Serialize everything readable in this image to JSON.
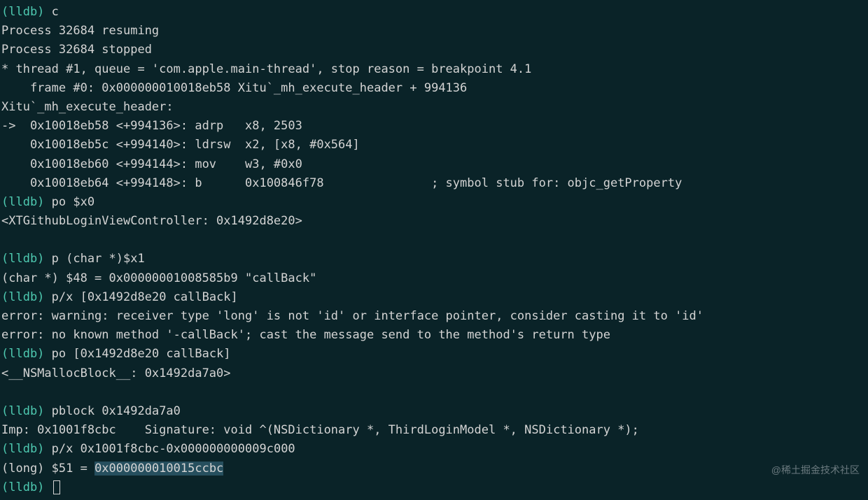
{
  "prompt": "(lldb)",
  "cmd1": "c",
  "out1": "Process 32684 resuming",
  "out2": "Process 32684 stopped",
  "out3": "* thread #1, queue = 'com.apple.main-thread', stop reason = breakpoint 4.1",
  "out4": "    frame #0: 0x000000010018eb58 Xitu`_mh_execute_header + 994136",
  "out5": "Xitu`_mh_execute_header:",
  "out6": "->  0x10018eb58 <+994136>: adrp   x8, 2503",
  "out7": "    0x10018eb5c <+994140>: ldrsw  x2, [x8, #0x564]",
  "out8": "    0x10018eb60 <+994144>: mov    w3, #0x0",
  "out9": "    0x10018eb64 <+994148>: b      0x100846f78               ; symbol stub for: objc_getProperty",
  "cmd2": "po $x0",
  "out10": "<XTGithubLoginViewController: 0x1492d8e20>",
  "blank": " ",
  "cmd3": "p (char *)$x1",
  "out11": "(char *) $48 = 0x00000001008585b9 \"callBack\"",
  "cmd4": "p/x [0x1492d8e20 callBack]",
  "out12": "error: warning: receiver type 'long' is not 'id' or interface pointer, consider casting it to 'id'",
  "out13": "error: no known method '-callBack'; cast the message send to the method's return type",
  "cmd5": "po [0x1492d8e20 callBack]",
  "out14": "<__NSMallocBlock__: 0x1492da7a0>",
  "cmd6": "pblock 0x1492da7a0",
  "out15": "Imp: 0x1001f8cbc    Signature: void ^(NSDictionary *, ThirdLoginModel *, NSDictionary *);",
  "cmd7": "p/x 0x1001f8cbc-0x000000000009c000",
  "out16a": "(long) $51 = ",
  "out16b": "0x000000010015ccbc",
  "watermark": "@稀土掘金技术社区"
}
